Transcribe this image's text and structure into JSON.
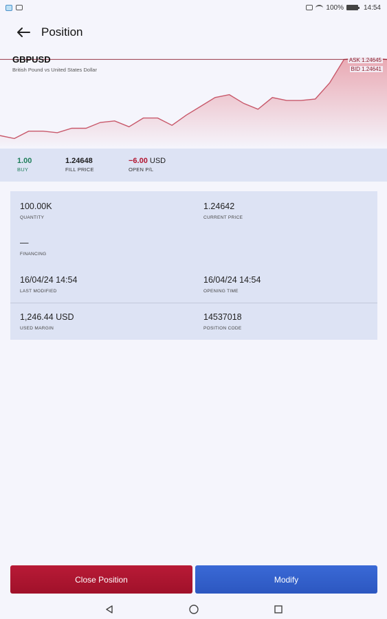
{
  "status_bar": {
    "battery": "100%",
    "time": "14:54"
  },
  "header": {
    "title": "Position",
    "back_icon": "arrow-left-icon"
  },
  "instrument": {
    "symbol": "GBPUSD",
    "description": "British Pound vs United States Dollar",
    "ask_label": "ASK 1.24645",
    "bid_label": "BID 1.24641"
  },
  "chart_data": {
    "type": "area",
    "x": [
      0,
      1,
      2,
      3,
      4,
      5,
      6,
      7,
      8,
      9,
      10,
      11,
      12,
      13,
      14,
      15,
      16,
      17,
      18,
      19,
      20,
      21,
      22,
      23,
      24,
      25,
      26,
      27
    ],
    "values": [
      1.2412,
      1.241,
      1.2415,
      1.2415,
      1.2414,
      1.2417,
      1.2417,
      1.2421,
      1.2422,
      1.2418,
      1.2424,
      1.2424,
      1.2419,
      1.2426,
      1.2432,
      1.2438,
      1.244,
      1.2434,
      1.243,
      1.2438,
      1.2436,
      1.2436,
      1.2437,
      1.2448,
      1.2464,
      1.2465,
      1.2465,
      1.2464
    ],
    "line_color": "#c8586a",
    "fill_top": "#e9a9b3",
    "fill_bottom": "#f5f5fc",
    "ylim": [
      1.2405,
      1.2468
    ],
    "bid_line": 1.24641,
    "grid": false
  },
  "summary": {
    "quantity": "1.00",
    "side": "BUY",
    "fill_price": "1.24648",
    "fill_price_label": "FILL PRICE",
    "open_pl": "−6.00",
    "open_pl_currency": "USD",
    "open_pl_label": "OPEN P/L"
  },
  "details": {
    "quantity_value": "100.00K",
    "quantity_label": "QUANTITY",
    "current_price_value": "1.24642",
    "current_price_label": "CURRENT PRICE",
    "financing_value": "—",
    "financing_label": "FINANCING",
    "last_modified_value": "16/04/24 14:54",
    "last_modified_label": "LAST MODIFIED",
    "opening_time_value": "16/04/24 14:54",
    "opening_time_label": "OPENING TIME",
    "used_margin_value": "1,246.44 USD",
    "used_margin_label": "USED MARGIN",
    "position_code_value": "14537018",
    "position_code_label": "POSITION CODE"
  },
  "actions": {
    "close_label": "Close Position",
    "modify_label": "Modify",
    "close_color": "#b01530",
    "modify_color": "#3161cc"
  },
  "nav": {
    "back_icon": "nav-back-icon",
    "home_icon": "nav-home-icon",
    "recents_icon": "nav-recents-icon"
  }
}
